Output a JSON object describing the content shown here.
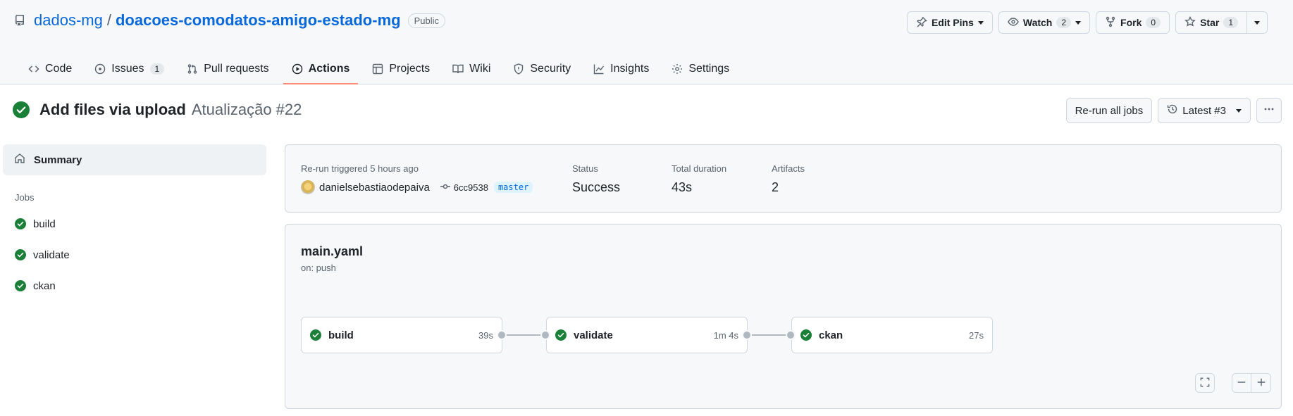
{
  "repo": {
    "owner": "dados-mg",
    "separator": "/",
    "name": "doacoes-comodatos-amigo-estado-mg",
    "visibility": "Public",
    "actions": {
      "edit_pins": "Edit Pins",
      "watch": "Watch",
      "watch_count": "2",
      "fork": "Fork",
      "fork_count": "0",
      "star": "Star",
      "star_count": "1"
    },
    "tabs": [
      {
        "label": "Code",
        "icon": "code-icon"
      },
      {
        "label": "Issues",
        "icon": "issue-icon",
        "count": "1"
      },
      {
        "label": "Pull requests",
        "icon": "pull-request-icon"
      },
      {
        "label": "Actions",
        "icon": "play-icon",
        "selected": true
      },
      {
        "label": "Projects",
        "icon": "table-icon"
      },
      {
        "label": "Wiki",
        "icon": "book-icon"
      },
      {
        "label": "Security",
        "icon": "shield-icon"
      },
      {
        "label": "Insights",
        "icon": "graph-icon"
      },
      {
        "label": "Settings",
        "icon": "gear-icon"
      }
    ]
  },
  "run": {
    "title": "Add files via upload",
    "subtitle": "Atualização #22",
    "rerun_label": "Re-run all jobs",
    "attempt_label": "Latest #3"
  },
  "sidebar": {
    "summary_label": "Summary",
    "jobs_heading": "Jobs",
    "jobs": [
      {
        "label": "build",
        "status": "success"
      },
      {
        "label": "validate",
        "status": "success"
      },
      {
        "label": "ckan",
        "status": "success"
      }
    ]
  },
  "summary": {
    "trigger_text": "Re-run triggered 5 hours ago",
    "actor": "danielsebastiaodepaiva",
    "commit": "6cc9538",
    "branch": "master",
    "status_label": "Status",
    "status_value": "Success",
    "duration_label": "Total duration",
    "duration_value": "43s",
    "artifacts_label": "Artifacts",
    "artifacts_value": "2"
  },
  "workflow": {
    "file": "main.yaml",
    "trigger": "on: push",
    "jobs": [
      {
        "name": "build",
        "duration": "39s"
      },
      {
        "name": "validate",
        "duration": "1m 4s"
      },
      {
        "name": "ckan",
        "duration": "27s"
      }
    ]
  },
  "colors": {
    "success": "#1a7f37",
    "link": "#0969da",
    "tab_underline": "#fd8c73"
  }
}
